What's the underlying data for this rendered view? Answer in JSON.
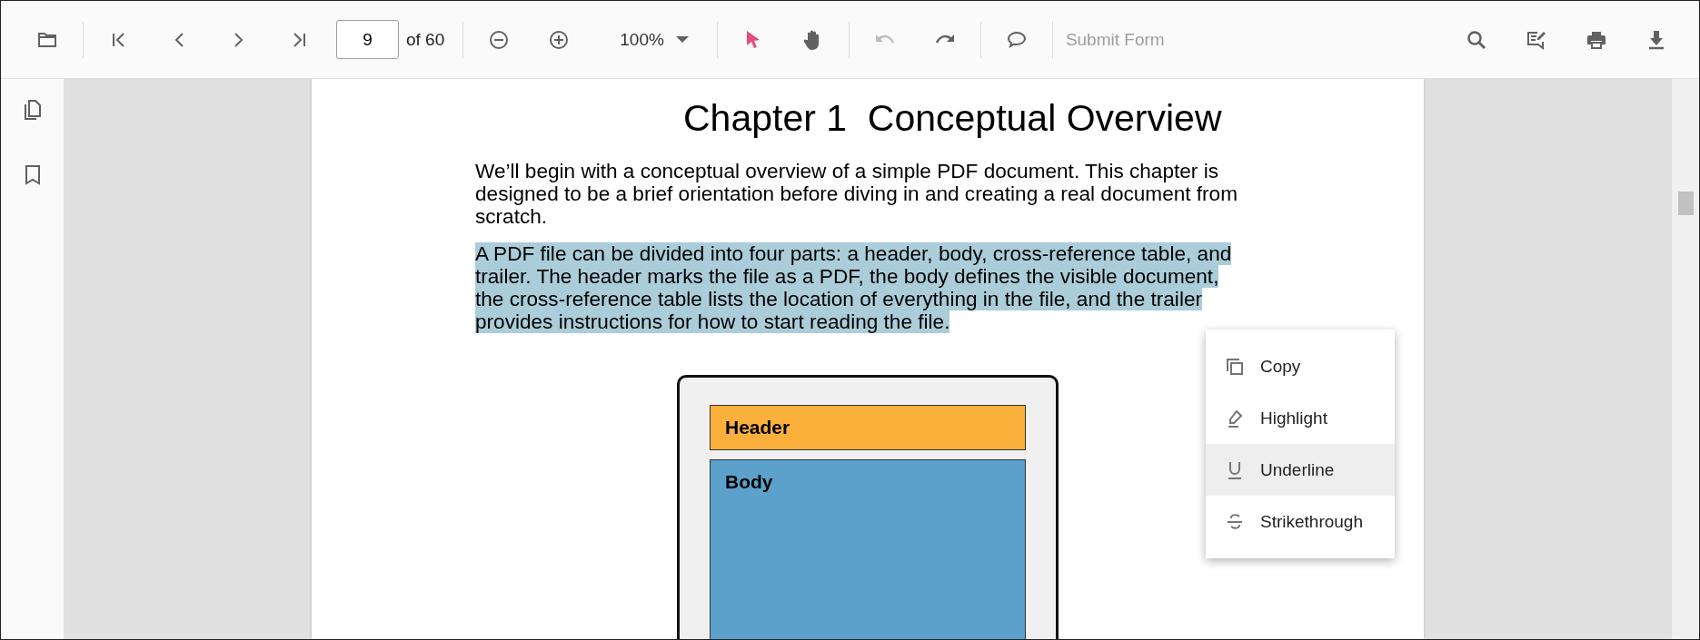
{
  "toolbar": {
    "page_number": "9",
    "page_count": "of 60",
    "zoom": "100%",
    "tools": [
      {
        "selected": true
      },
      {
        "selected": false
      }
    ],
    "undo": {
      "disabled": true
    },
    "redo": {
      "disabled": false
    },
    "submit_form": {
      "label": "Submit Form",
      "disabled": true
    }
  },
  "document": {
    "title": "Chapter 1  Conceptual Overview",
    "paragraphs": [
      {
        "text": "We’ll begin with a conceptual overview of a simple PDF document. This chapter is designed to be a brief orientation before diving in and creating a real document from scratch.",
        "selected": false
      },
      {
        "text": "A PDF file can be divided into four parts: a header, body, cross-reference table, and trailer. The header marks the file as a PDF, the body defines the visible document, the cross-reference table lists the location of everything in the file, and the trailer provides instructions for how to start reading the file.",
        "selected": true
      }
    ],
    "figure": {
      "header_label": "Header",
      "body_label": "Body"
    }
  },
  "context_menu": [
    {
      "label": "Copy",
      "selected": false
    },
    {
      "label": "Highlight",
      "selected": false
    },
    {
      "label": "Underline",
      "selected": true
    },
    {
      "label": "Strikethrough",
      "selected": false
    }
  ]
}
